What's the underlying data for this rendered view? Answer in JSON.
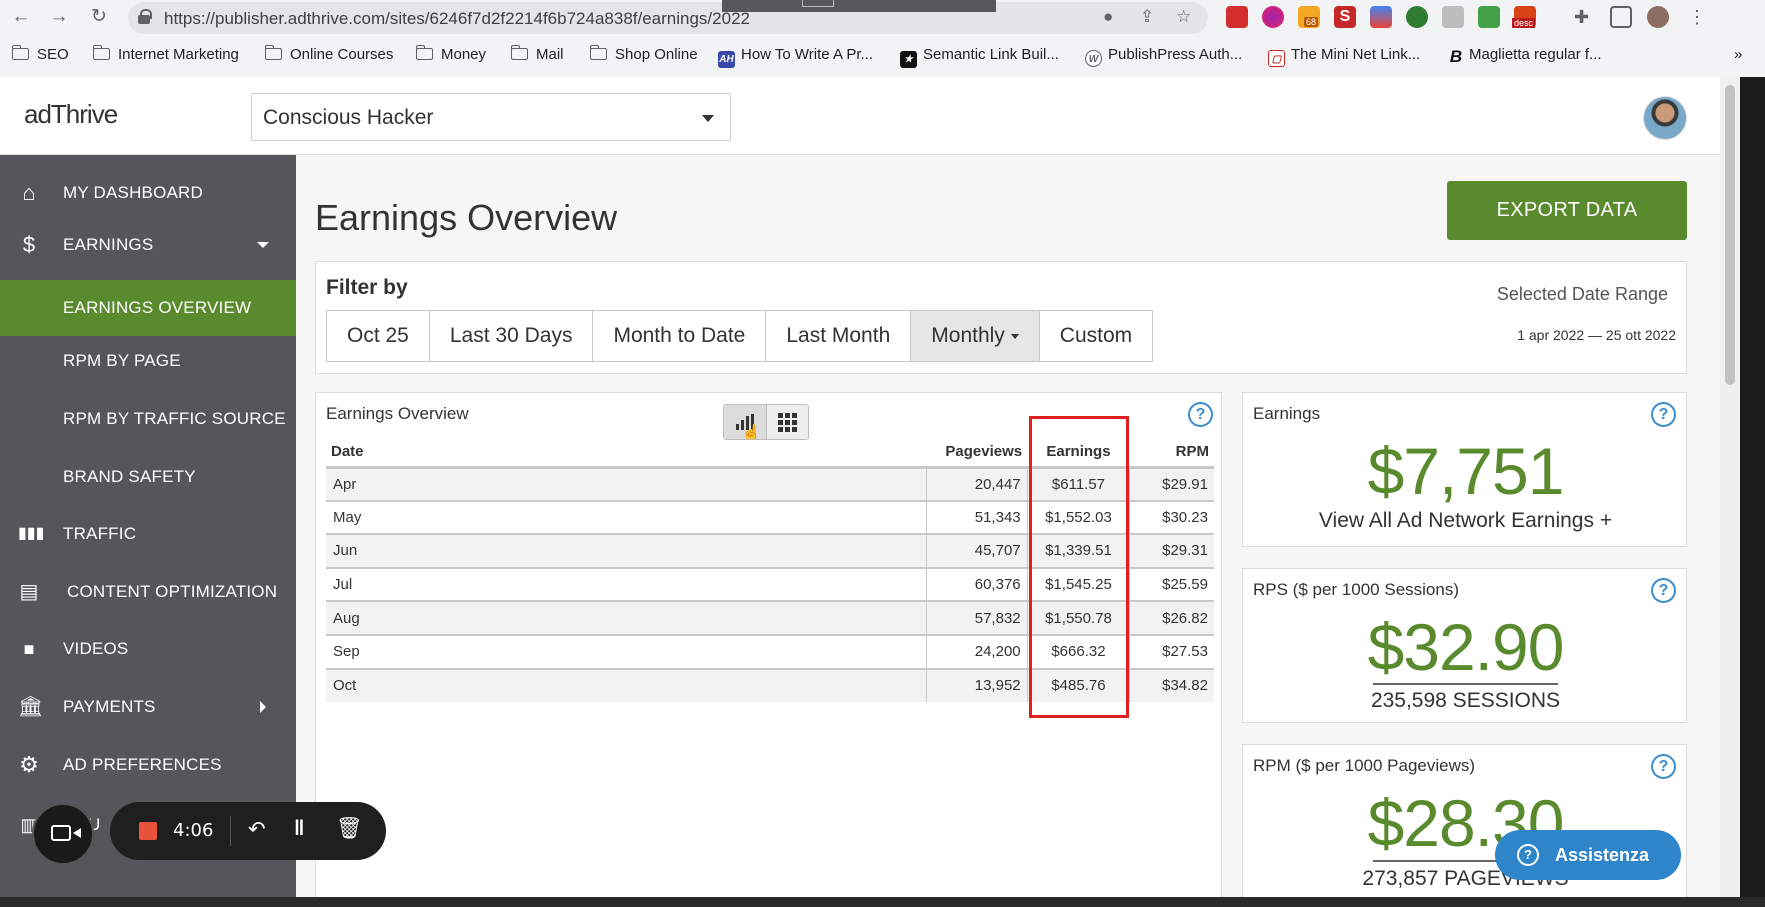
{
  "browser": {
    "url": "https://publisher.adthrive.com/sites/6246f7d2f2214f6b724a838f/earnings/2022",
    "bookmarks": [
      "SEO",
      "Internet Marketing",
      "Online Courses",
      "Money",
      "Mail",
      "Shop Online",
      "How To Write A Pr...",
      "Semantic Link Buil...",
      "PublishPress Auth...",
      "The Mini Net Link...",
      "Maglietta regular f..."
    ],
    "bookmarks_more": "»",
    "ext_badge_1": "68",
    "ext_badge_2": "desc"
  },
  "header": {
    "logo": "adThrive",
    "site_select": "Conscious Hacker"
  },
  "sidebar": {
    "items": [
      {
        "label": "MY DASHBOARD",
        "icon": "home-icon"
      },
      {
        "label": "EARNINGS",
        "icon": "dollar-icon"
      },
      {
        "label": "EARNINGS OVERVIEW"
      },
      {
        "label": "RPM BY PAGE"
      },
      {
        "label": "RPM BY TRAFFIC SOURCE"
      },
      {
        "label": "BRAND SAFETY"
      },
      {
        "label": "TRAFFIC",
        "icon": "bar-chart-icon"
      },
      {
        "label": "CONTENT OPTIMIZATION",
        "icon": "document-icon"
      },
      {
        "label": "VIDEOS",
        "icon": "video-icon"
      },
      {
        "label": "PAYMENTS",
        "icon": "bank-icon"
      },
      {
        "label": "AD PREFERENCES",
        "icon": "gear-icon"
      },
      {
        "label": "SOU",
        "icon": "book-icon"
      }
    ]
  },
  "main": {
    "title": "Earnings Overview",
    "export_label": "EXPORT DATA",
    "filter": {
      "title": "Filter by",
      "buttons": [
        "Oct 25",
        "Last 30 Days",
        "Month to Date",
        "Last Month",
        "Monthly",
        "Custom"
      ],
      "range_label": "Selected Date Range",
      "range_value": "1 apr 2022 — 25 ott 2022"
    },
    "table": {
      "title": "Earnings Overview",
      "headers": [
        "Date",
        "Pageviews",
        "Earnings",
        "RPM"
      ],
      "rows": [
        [
          "Apr",
          "20,447",
          "$611.57",
          "$29.91"
        ],
        [
          "May",
          "51,343",
          "$1,552.03",
          "$30.23"
        ],
        [
          "Jun",
          "45,707",
          "$1,339.51",
          "$29.31"
        ],
        [
          "Jul",
          "60,376",
          "$1,545.25",
          "$25.59"
        ],
        [
          "Aug",
          "57,832",
          "$1,550.78",
          "$26.82"
        ],
        [
          "Sep",
          "24,200",
          "$666.32",
          "$27.53"
        ],
        [
          "Oct",
          "13,952",
          "$485.76",
          "$34.82"
        ]
      ]
    },
    "earnings_card": {
      "title": "Earnings",
      "value": "$7,751",
      "link": "View All Ad Network Earnings +"
    },
    "rps_card": {
      "title": "RPS ($ per 1000 Sessions)",
      "value": "$32.90",
      "sub": "235,598 SESSIONS"
    },
    "rpm_card": {
      "title": "RPM ($ per 1000 Pageviews)",
      "value": "$28.30",
      "sub": "273,857 PAGEVIEWS"
    }
  },
  "recorder": {
    "time": "4:06"
  },
  "assist": {
    "label": "Assistenza"
  },
  "colors": {
    "brand_green": "#5a8a2e",
    "sidebar_bg": "#55555a",
    "highlight": "#e02020",
    "help_blue": "#3b8ed2"
  }
}
